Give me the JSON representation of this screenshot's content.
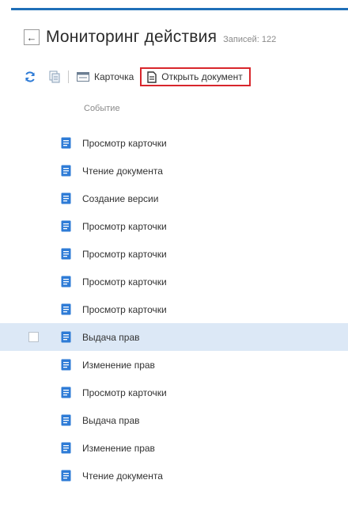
{
  "header": {
    "back_icon": "arrow-left-icon",
    "title": "Мониторинг действия",
    "records": "Записей: 122"
  },
  "toolbar": {
    "refresh_icon": "refresh-icon",
    "copy_icon": "copy-icon",
    "card_label": "Карточка",
    "open_doc_label": "Открыть документ"
  },
  "table": {
    "column_header": "Событие",
    "rows": [
      {
        "event": "Просмотр карточки"
      },
      {
        "event": "Чтение документа"
      },
      {
        "event": "Создание версии"
      },
      {
        "event": "Просмотр карточки"
      },
      {
        "event": "Просмотр карточки"
      },
      {
        "event": "Просмотр карточки"
      },
      {
        "event": "Просмотр карточки"
      },
      {
        "event": "Выдача прав",
        "selected": true
      },
      {
        "event": "Изменение прав"
      },
      {
        "event": "Просмотр карточки"
      },
      {
        "event": "Выдача прав"
      },
      {
        "event": "Изменение прав"
      },
      {
        "event": "Чтение документа"
      }
    ]
  },
  "colors": {
    "accent": "#1f6fb8",
    "highlight_border": "#d8262c",
    "selected_row": "#dce8f6",
    "doc_icon": "#2e7bd6"
  }
}
